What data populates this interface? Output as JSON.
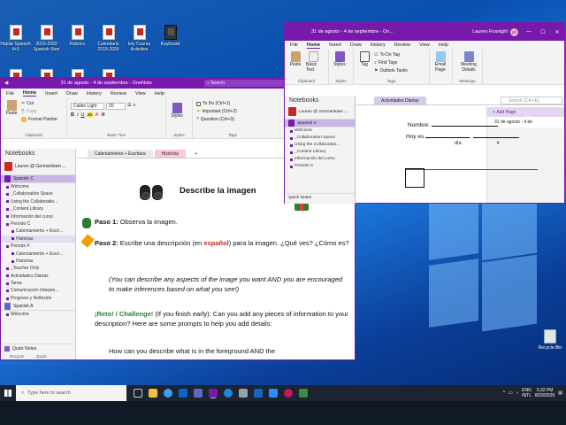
{
  "desktop": {
    "icons": [
      {
        "label": "Hablar Spanish 4+5"
      },
      {
        "label": "2019-2020 Spanish Stan"
      },
      {
        "label": "Rubrics"
      },
      {
        "label": "Calendario 2019-2020"
      },
      {
        "label": "key Course Activities"
      },
      {
        "label": "Keyboard"
      }
    ],
    "row2": [
      {
        "label": ""
      },
      {
        "label": ""
      },
      {
        "label": ""
      },
      {
        "label": ""
      }
    ],
    "recycle_bin": "Recycle Bin"
  },
  "main_window": {
    "title": "31 de agosto - 4 de septiembre - OneNote",
    "search_label": "Search",
    "tabs": [
      "File",
      "Home",
      "Insert",
      "Draw",
      "History",
      "Review",
      "View",
      "Help"
    ],
    "active_tab": "Home",
    "ribbon": {
      "paste": "Paste",
      "cut": "Cut",
      "copy": "Copy",
      "format_painter": "Format Painter",
      "clipboard": "Clipboard",
      "font": "Calibri Light",
      "size": "20",
      "basic_text": "Basic Text",
      "styles": "Styles",
      "styles_group": "Styles",
      "tags": [
        "To Do (Ctrl+1)",
        "Important (Ctrl+2)",
        "Question (Ctrl+3)"
      ],
      "tag_label": "Tag",
      "tags_group": "Tags"
    },
    "nav": {
      "title": "Notebooks",
      "notebook": "Lauren @ Germantown ...",
      "section": "Spanish C",
      "pages": [
        "Welcome",
        "_Collaboration Space",
        "Using the Collaboratio...",
        "_Content Library",
        "Información del curso",
        "Periodo C",
        "Calentamiento + Escri...",
        "Historias",
        "Periodo F",
        "Calentamiento + Escri...",
        "Historias",
        "_Teacher Only",
        "Actividades Diarias",
        "Tarea",
        "Comunicación Interpre...",
        "Progreso y Reflexión"
      ],
      "section2": "Spanish A",
      "section2_pages": [
        "Welcome"
      ],
      "quick_notes": "Quick Notes",
      "status_left": "Recycle",
      "status_right": "Quick"
    },
    "section_tabs": [
      {
        "label": "Calentamiento + Escritura"
      },
      {
        "label": "Historias"
      },
      {
        "label": "+"
      }
    ],
    "page": {
      "heading": "Describe la imagen",
      "step1_label": "Paso 1:",
      "step1_text": " Observa la imagen.",
      "step2_label": "Paso 2:",
      "step2_text_a": " Escribe una descripción (en ",
      "step2_highlight": "español",
      "step2_text_b": ") para la imagen. ¿Qué ves? ¿Cómo es?",
      "italic_note": "(You can describe any aspects of the image you want AND you are encouraged to make inferences based on what you see!)",
      "challenge_label": "¡Reto! / Challenge!",
      "challenge_text": " (If you finish early): Can you add any pieces of information to your description? Here are some prompts to help you add details:",
      "footer_text": "How can you describe what is in the foreground AND the"
    }
  },
  "second_window": {
    "title": "31 de agosto - 4 de septiembre - On...",
    "user": "Lauren Fosnight",
    "user_initials": "LF",
    "tabs": [
      "File",
      "Home",
      "Insert",
      "Draw",
      "History",
      "Review",
      "View",
      "Help"
    ],
    "ribbon": {
      "paste": "Paste",
      "basic_text": "Basic Text",
      "styles": "Styles",
      "tag": "Tag",
      "todo_tag": "To Do Tag",
      "find_tags": "Find Tags",
      "outlook_tasks": "Outlook Tasks",
      "email": "Email Page",
      "meeting": "Meeting Details",
      "groups": [
        "Clipboard",
        "Styles",
        "Tags",
        "Meetings"
      ]
    },
    "nav": {
      "title": "Notebooks",
      "notebook": "Lauren @ Germantown ...",
      "section": "Spanish C",
      "pages": [
        "Welcome",
        "_Collaboration Space",
        "Using the Collaboratio...",
        "_Content Library",
        "Información del curso",
        "Periodo C"
      ],
      "quick_notes": "Quick Notes"
    },
    "section_tab": "Actividades Diarias",
    "search_placeholder": "Search (Ctrl+E)",
    "add_page": "Add Page",
    "page_item": "31 de agosto - 4 de",
    "form": {
      "nombre": "Nombre:",
      "hoy_es": "Hoy es",
      "dia": "día",
      "num": "#",
      "c": "C"
    }
  },
  "taskbar": {
    "search_placeholder": "Type here to search",
    "language": "ENG",
    "locale": "INTL",
    "time": "5:32 PM",
    "date": "8/20/2020"
  },
  "colors": {
    "onenote_purple": "#7719aa",
    "taskbar": "#1b2430",
    "desktop_blue": "#1a5fb4"
  }
}
